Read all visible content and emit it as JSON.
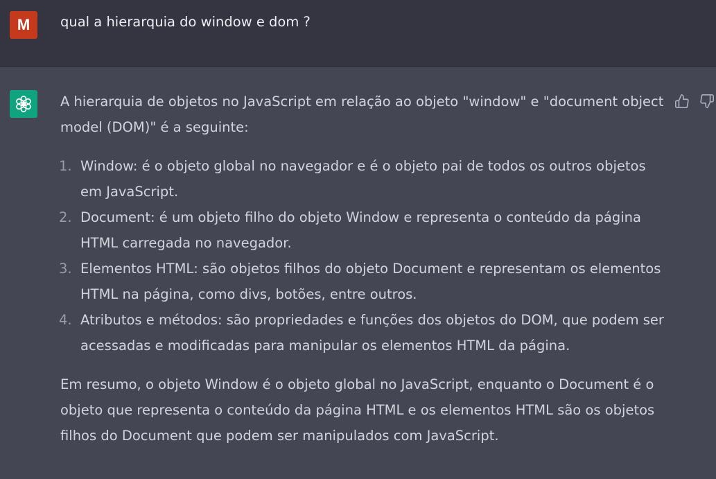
{
  "user_message": {
    "avatar_letter": "M",
    "text": "qual a hierarquia do window e dom ?"
  },
  "assistant_message": {
    "intro": "A hierarquia de objetos no JavaScript em relação ao objeto \"window\" e \"document object model (DOM)\" é a seguinte:",
    "items": [
      {
        "number": "1.",
        "text": "Window: é o objeto global no navegador e é o objeto pai de todos os outros objetos em JavaScript."
      },
      {
        "number": "2.",
        "text": "Document: é um objeto filho do objeto Window e representa o conteúdo da página HTML carregada no navegador."
      },
      {
        "number": "3.",
        "text": "Elementos HTML: são objetos filhos do objeto Document e representam os elementos HTML na página, como divs, botões, entre outros."
      },
      {
        "number": "4.",
        "text": "Atributos e métodos: são propriedades e funções dos objetos do DOM, que podem ser acessadas e modificadas para manipular os elementos HTML da página."
      }
    ],
    "summary": "Em resumo, o objeto Window é o objeto global no JavaScript, enquanto o Document é o objeto que representa o conteúdo da página HTML e os elementos HTML são os objetos filhos do Document que podem ser manipulados com JavaScript."
  },
  "icons": {
    "bot_avatar": "openai-logo-icon",
    "like": "thumbs-up-icon",
    "dislike": "thumbs-down-icon"
  },
  "colors": {
    "user_bg": "#343541",
    "assistant_bg": "#444654",
    "user_avatar": "#c5391c",
    "bot_avatar": "#10a37f",
    "text": "#d1d5db"
  }
}
